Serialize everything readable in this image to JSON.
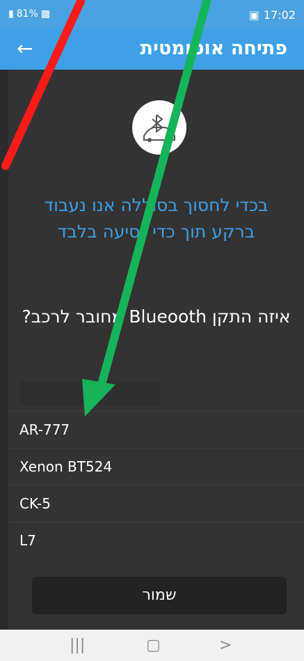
{
  "status": {
    "battery": "81%",
    "time": "17:02"
  },
  "appbar": {
    "title": "פתיחה אוטומטית"
  },
  "main": {
    "note_line1": "בכדי לחסוך בסוללה אנו נעבוד",
    "note_line2": "ברקע תוך כדי נסיעה בלבד",
    "question": "איזה התקן Blueooth מחובר לרכב?"
  },
  "devices": [
    "AR-777",
    "Xenon BT524",
    "CK-5",
    "L7"
  ],
  "save_label": "שמור",
  "colors": {
    "primary": "#3ea0e6",
    "background": "#333333",
    "arrow_red": "#ff1a1a",
    "arrow_green": "#16b45a"
  }
}
